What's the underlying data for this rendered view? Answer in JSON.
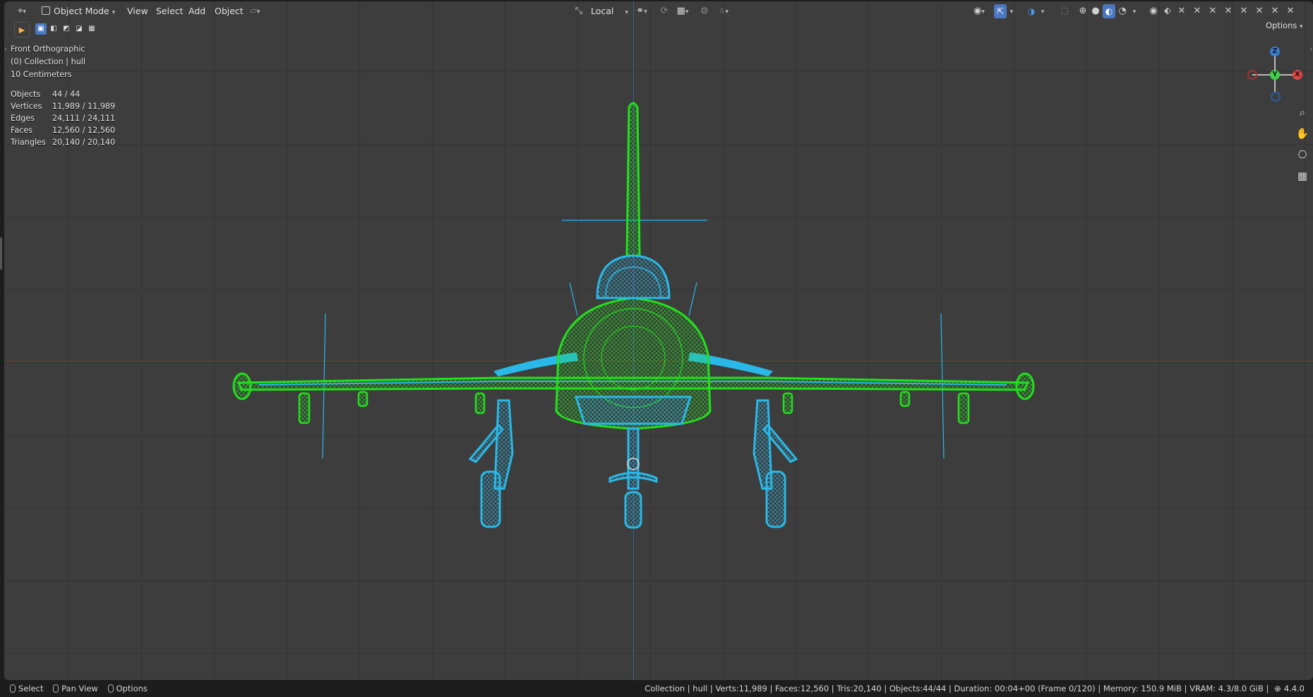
{
  "header": {
    "mode_label": "Object Mode",
    "menu": [
      "View",
      "Select",
      "Add",
      "Object"
    ],
    "transform_orientation": "Local",
    "options_label": "Options"
  },
  "overlay": {
    "view_name": "Front Orthographic",
    "collection_line": "(0) Collection | hull",
    "scale_line": "10 Centimeters",
    "stats": [
      {
        "label": "Objects",
        "value": "44 / 44"
      },
      {
        "label": "Vertices",
        "value": "11,989 / 11,989"
      },
      {
        "label": "Edges",
        "value": "24,111 / 24,111"
      },
      {
        "label": "Faces",
        "value": "12,560 / 12,560"
      },
      {
        "label": "Triangles",
        "value": "20,140 / 20,140"
      }
    ]
  },
  "gizmo": {
    "z": "Z",
    "y": "Y",
    "x": "X"
  },
  "statusbar": {
    "left": [
      {
        "label": "Select"
      },
      {
        "label": "Pan View"
      },
      {
        "label": "Options"
      }
    ],
    "info": "Collection | hull | Verts:11,989 | Faces:12,560 | Tris:20,140 | Objects:44/44 | Duration: 00:04+00 (Frame 0/120) | Memory: 150.9 MiB | VRAM: 4.3/8.0 GiB | ",
    "version": "4.4.0"
  },
  "colors": {
    "viewport_bg": "#3d3d3d",
    "wire_green": "#22e01c",
    "wire_cyan": "#2ab8e8",
    "accent_blue": "#4b77c0"
  }
}
